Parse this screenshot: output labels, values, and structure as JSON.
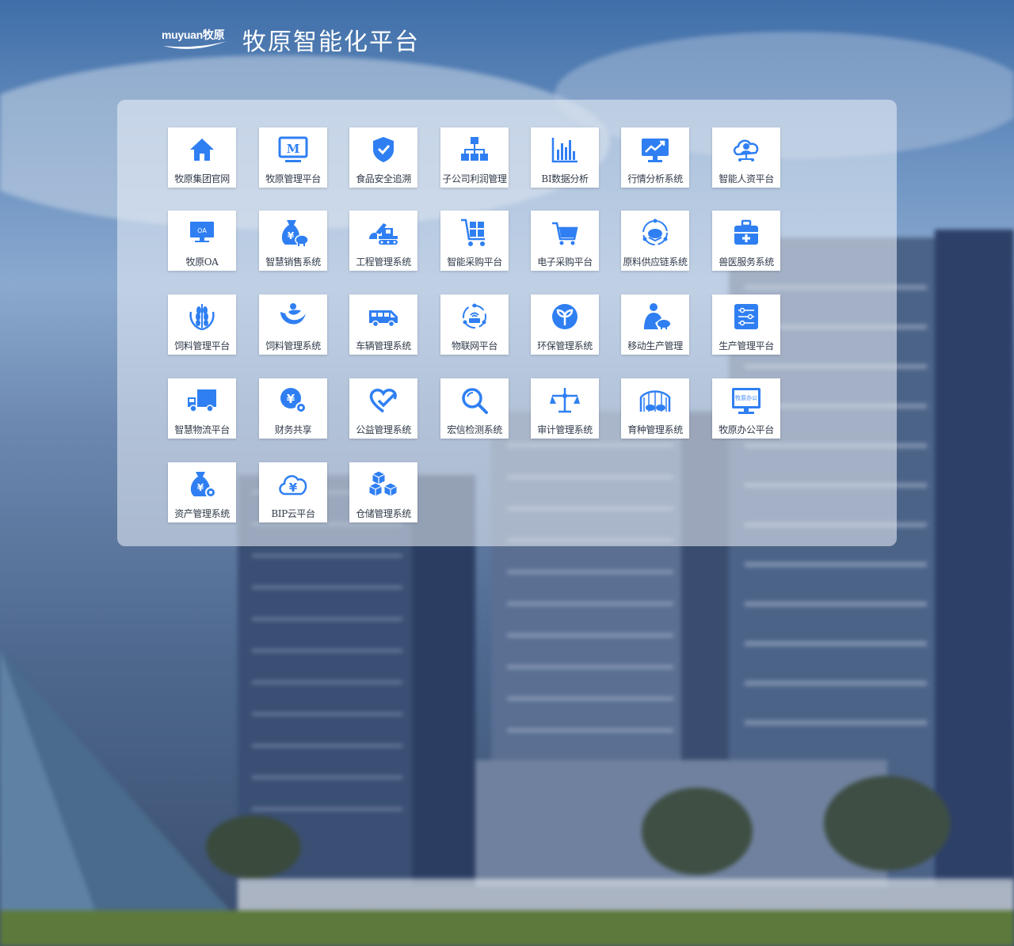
{
  "header": {
    "logo_text": "muyuan牧原",
    "title": "牧原智能化平台"
  },
  "colors": {
    "icon_blue": "#2f7ff2",
    "tile_bg": "#ffffff",
    "label": "#303a4a"
  },
  "apps": [
    {
      "label": "牧原集团官网",
      "icon": "home-icon"
    },
    {
      "label": "牧原管理平台",
      "icon": "monitor-m-icon"
    },
    {
      "label": "食品安全追溯",
      "icon": "shield-check-icon"
    },
    {
      "label": "子公司利润管理",
      "icon": "org-chart-icon"
    },
    {
      "label": "BI数据分析",
      "icon": "bar-chart-icon"
    },
    {
      "label": "行情分析系统",
      "icon": "trend-monitor-icon"
    },
    {
      "label": "智能人资平台",
      "icon": "cloud-person-icon"
    },
    {
      "label": "牧原OA",
      "icon": "oa-monitor-icon"
    },
    {
      "label": "智慧销售系统",
      "icon": "money-bag-pig-icon"
    },
    {
      "label": "工程管理系统",
      "icon": "excavator-icon"
    },
    {
      "label": "智能采购平台",
      "icon": "cart-boxes-icon"
    },
    {
      "label": "电子采购平台",
      "icon": "shopping-cart-icon"
    },
    {
      "label": "原料供应链系统",
      "icon": "supply-cycle-icon"
    },
    {
      "label": "兽医服务系统",
      "icon": "medical-kit-icon"
    },
    {
      "label": "饲料管理平台",
      "icon": "wheat-icon"
    },
    {
      "label": "饲料管理系统",
      "icon": "leaf-globe-icon"
    },
    {
      "label": "车辆管理系统",
      "icon": "van-icon"
    },
    {
      "label": "物联网平台",
      "icon": "iot-router-icon"
    },
    {
      "label": "环保管理系统",
      "icon": "sprout-circle-icon"
    },
    {
      "label": "移动生产管理",
      "icon": "person-pig-icon"
    },
    {
      "label": "生产管理平台",
      "icon": "sliders-icon"
    },
    {
      "label": "智慧物流平台",
      "icon": "truck-icon"
    },
    {
      "label": "财务共享",
      "icon": "yen-gear-icon"
    },
    {
      "label": "公益管理系统",
      "icon": "heart-check-icon"
    },
    {
      "label": "宏信检测系统",
      "icon": "magnifier-icon"
    },
    {
      "label": "审计管理系统",
      "icon": "balance-scale-icon"
    },
    {
      "label": "育种管理系统",
      "icon": "breeding-shed-icon"
    },
    {
      "label": "牧原办公平台",
      "icon": "office-monitor-icon"
    },
    {
      "label": "资产管理系统",
      "icon": "asset-bag-gear-icon"
    },
    {
      "label": "BIP云平台",
      "icon": "yen-cloud-icon"
    },
    {
      "label": "仓储管理系统",
      "icon": "stacked-boxes-icon"
    }
  ],
  "office_monitor_text": "牧原办公",
  "oa_monitor_text": "OA",
  "monitor_m_text": "M"
}
